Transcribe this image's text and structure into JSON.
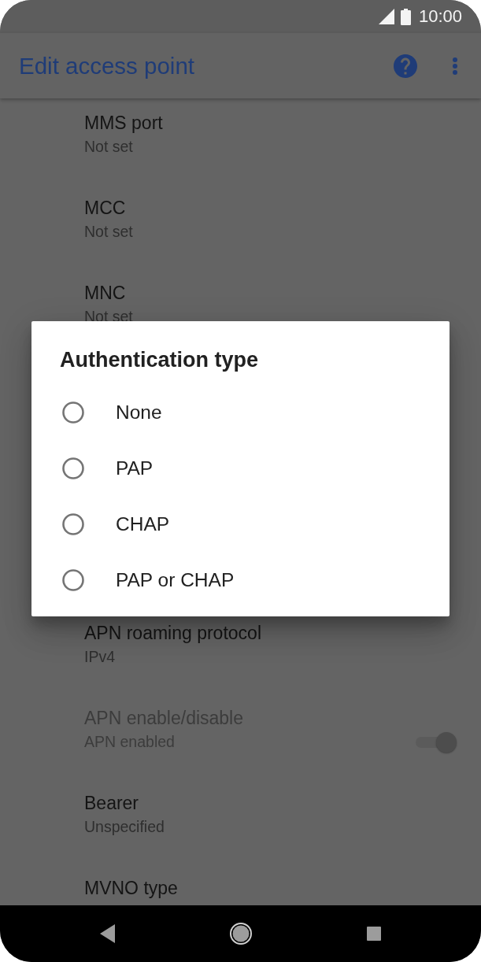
{
  "status_bar": {
    "time": "10:00"
  },
  "app_bar": {
    "title": "Edit access point"
  },
  "settings_top": [
    {
      "kind": "text",
      "title": "MMS port",
      "value": "Not set",
      "disabled": false
    },
    {
      "kind": "text",
      "title": "MCC",
      "value": "Not set",
      "disabled": false
    },
    {
      "kind": "text",
      "title": "MNC",
      "value": "Not set",
      "disabled": false
    }
  ],
  "dialog": {
    "title": "Authentication type",
    "options": [
      {
        "label": "None",
        "selected": false
      },
      {
        "label": "PAP",
        "selected": false
      },
      {
        "label": "CHAP",
        "selected": false
      },
      {
        "label": "PAP or CHAP",
        "selected": false
      }
    ]
  },
  "settings_bottom": [
    {
      "kind": "text",
      "title": "APN roaming protocol",
      "value": "IPv4",
      "disabled": false
    },
    {
      "kind": "switch",
      "title": "APN enable/disable",
      "value": "APN enabled",
      "disabled": true,
      "on": true
    },
    {
      "kind": "text",
      "title": "Bearer",
      "value": "Unspecified",
      "disabled": false
    },
    {
      "kind": "text",
      "title": "MVNO type",
      "disabled": false
    }
  ]
}
